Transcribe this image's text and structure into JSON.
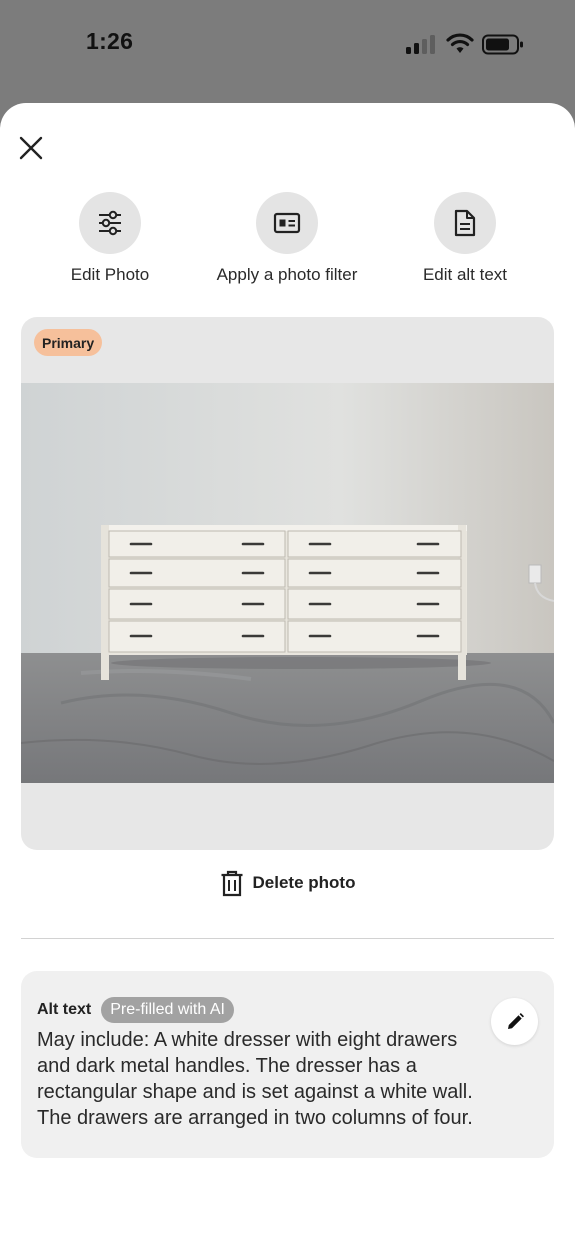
{
  "status_bar": {
    "time": "1:26"
  },
  "actions": [
    {
      "label": "Edit Photo",
      "icon": "sliders-icon"
    },
    {
      "label": "Apply a photo filter",
      "icon": "photo-filter-icon"
    },
    {
      "label": "Edit alt text",
      "icon": "document-icon"
    }
  ],
  "photo": {
    "badge": "Primary",
    "delete_label": "Delete photo"
  },
  "alt_text": {
    "title": "Alt text",
    "badge": "Pre-filled with AI",
    "body": "May include: A white dresser with eight drawers and dark metal handles. The dresser has a rectangular shape and is set against a white wall. The drawers are arranged in two columns of four."
  },
  "colors": {
    "badge_primary": "#f6c09b",
    "ai_badge": "#a2a2a2",
    "backdrop": "#7c7c7c"
  }
}
